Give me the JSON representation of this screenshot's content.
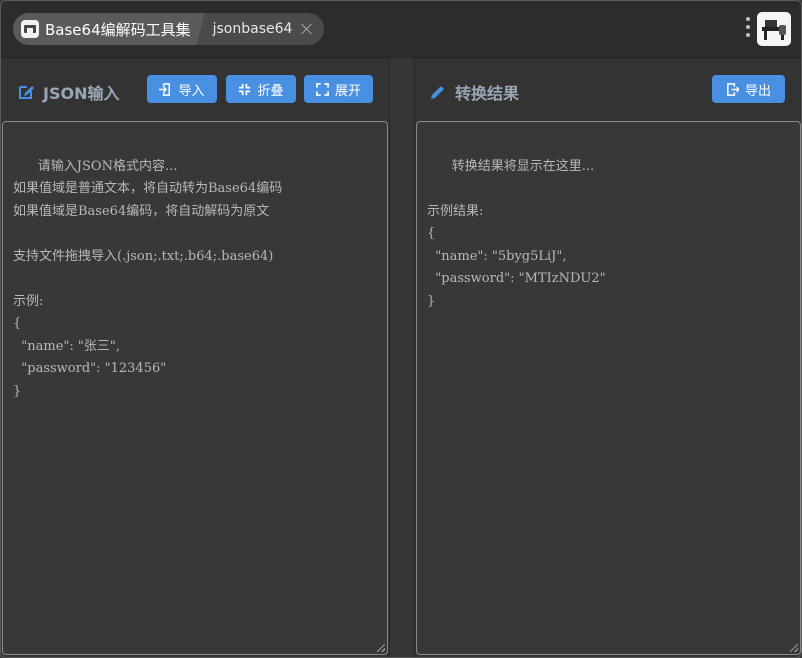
{
  "header": {
    "app_tab_label": "Base64编解码工具集",
    "file_tab_label": "jsonbase64"
  },
  "left_panel": {
    "title": "JSON输入",
    "buttons": {
      "import_label": "导入",
      "fold_label": "折叠",
      "expand_label": "展开"
    },
    "placeholder": "请输入JSON格式内容...\n如果值域是普通文本，将自动转为Base64编码\n如果值域是Base64编码，将自动解码为原文\n\n支持文件拖拽导入(.json;.txt;.b64;.base64)\n\n示例:\n{\n  \"name\": \"张三\",\n  \"password\": \"123456\"\n}"
  },
  "right_panel": {
    "title": "转换结果",
    "buttons": {
      "export_label": "导出"
    },
    "placeholder": "转换结果将显示在这里...\n\n示例结果:\n{\n  \"name\": \"5byg5LiJ\",\n  \"password\": \"MTIzNDU2\"\n}"
  },
  "colors": {
    "accent": "#4a90e2",
    "panel_bg": "#333333",
    "title_text": "#9aa6b4",
    "placeholder_text": "#b8b8b8"
  },
  "icons": {
    "app": "app-logo-icon",
    "close": "close-icon",
    "menu": "more-vertical-icon",
    "edit": "edit-square-icon",
    "pencil": "pencil-icon",
    "import": "file-import-icon",
    "fold": "compress-icon",
    "expand": "expand-icon",
    "export": "file-export-icon"
  }
}
